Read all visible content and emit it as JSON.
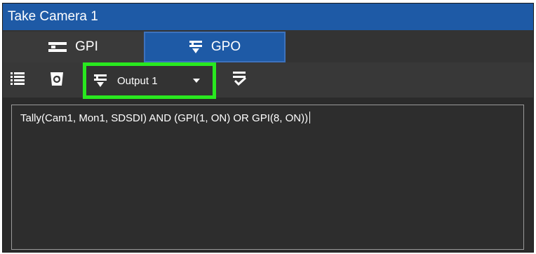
{
  "window": {
    "title": "Take Camera 1"
  },
  "tabs": [
    {
      "label": "GPI",
      "icon": "gpi-icon",
      "selected": false
    },
    {
      "label": "GPO",
      "icon": "gpo-icon",
      "selected": true
    }
  ],
  "toolbar": {
    "output_select": {
      "value": "Output 1",
      "icon": "gpo-icon"
    },
    "buttons": [
      "list-icon",
      "bucket-icon",
      "validate-icon"
    ]
  },
  "editor": {
    "text": "Tally(Cam1, Mon1, SDSDI) AND (GPI(1, ON) OR GPI(8, ON))"
  },
  "colors": {
    "accent": "#1e5aa6",
    "highlight": "#29e81f",
    "background": "#2b2b2b"
  }
}
